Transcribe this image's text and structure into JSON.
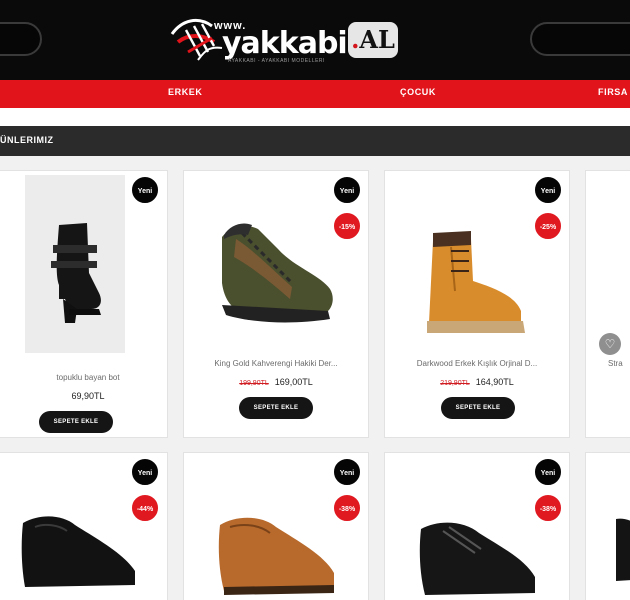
{
  "header": {
    "logo_www": "www.",
    "logo_word": "yakkabi",
    "logo_al": "AL",
    "logo_tagline": "AYAKKABI - AYAKKABI MODELLERI"
  },
  "nav": {
    "items": [
      "ERKEK",
      "ÇOCUK",
      "FIRSA"
    ]
  },
  "section": {
    "title": "ÜNLERIMIZ"
  },
  "products": [
    {
      "name": "topuklu bayan bot",
      "old_price": "",
      "price": "69,90TL",
      "badges": [
        "Yeni"
      ],
      "button": "SEPETE EKLE"
    },
    {
      "name": "King Gold Kahverengi Hakiki Der...",
      "old_price": "199,90TL",
      "price": "169,00TL",
      "badges": [
        "Yeni",
        "-15%"
      ],
      "button": "SEPETE EKLE"
    },
    {
      "name": "Darkwood Erkek Kışlık Orjinal D...",
      "old_price": "219,90TL",
      "price": "164,90TL",
      "badges": [
        "Yeni",
        "-25%"
      ],
      "button": "SEPETE EKLE"
    },
    {
      "name": "Stra",
      "old_price": "",
      "price": "",
      "badges": [],
      "button": ""
    },
    {
      "name": "",
      "old_price": "",
      "price": "",
      "badges": [
        "Yeni",
        "-44%"
      ],
      "button": ""
    },
    {
      "name": "",
      "old_price": "",
      "price": "",
      "badges": [
        "Yeni",
        "-38%"
      ],
      "button": ""
    },
    {
      "name": "",
      "old_price": "",
      "price": "",
      "badges": [
        "Yeni",
        "-38%"
      ],
      "button": ""
    }
  ],
  "colors": {
    "brand_red": "#e1141b",
    "header_black": "#0a0a0a",
    "section_dark": "#2b2b2b"
  },
  "icons": [
    "heart-icon",
    "shoelace-logo-icon"
  ]
}
